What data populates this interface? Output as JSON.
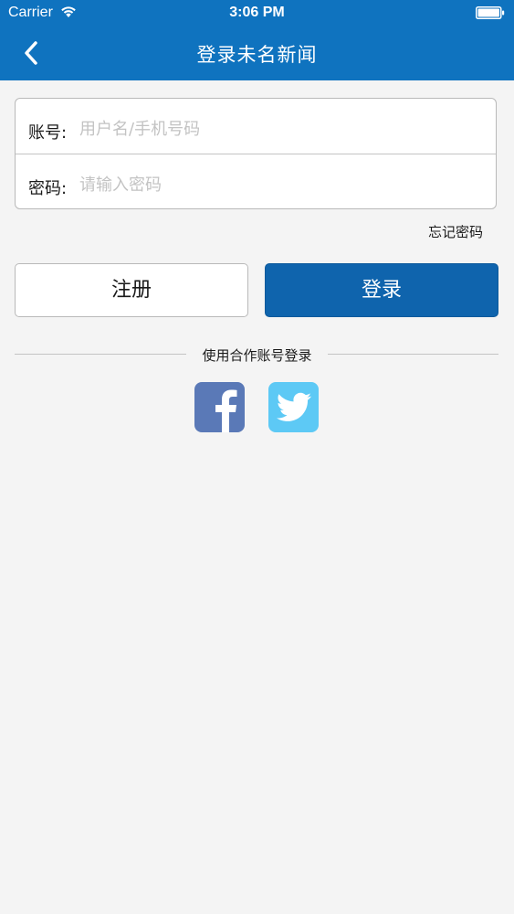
{
  "status_bar": {
    "carrier": "Carrier",
    "time": "3:06 PM"
  },
  "nav": {
    "title": "登录未名新闻"
  },
  "form": {
    "account_label": "账号:",
    "account_placeholder": "用户名/手机号码",
    "password_label": "密码:",
    "password_placeholder": "请输入密码"
  },
  "forgot_password": "忘记密码",
  "buttons": {
    "register": "注册",
    "login": "登录"
  },
  "third_party": {
    "label": "使用合作账号登录",
    "icons": [
      "facebook-icon",
      "twitter-icon"
    ]
  },
  "colors": {
    "primary": "#0f73bf",
    "login_button": "#0f64ad",
    "facebook": "#5a79b7",
    "twitter": "#5dc9f5",
    "background": "#f4f4f4"
  }
}
